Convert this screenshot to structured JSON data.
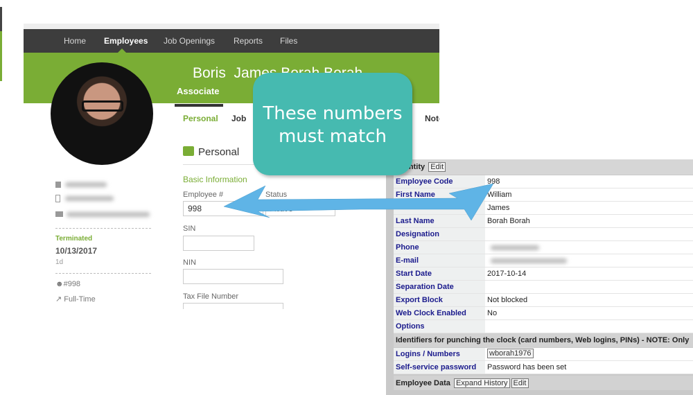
{
  "nav": {
    "items": [
      "Home",
      "Employees",
      "Job Openings",
      "Reports",
      "Files"
    ],
    "active": "Employees"
  },
  "profile": {
    "first": "Boris",
    "rest": "James Borah Borah",
    "role": "Associate",
    "status_label": "Terminated",
    "status_date": "10/13/2017",
    "status_age": "1d",
    "employee_no": "#998",
    "employment_type": "Full-Time"
  },
  "tabs": [
    "Personal",
    "Job",
    "Note"
  ],
  "personal": {
    "heading": "Personal",
    "section": "Basic Information",
    "employee_label": "Employee #",
    "employee_value": "998",
    "status_label": "Status",
    "status_value": "Active",
    "sin_label": "SIN",
    "nin_label": "NIN",
    "tfn_label": "Tax File Number"
  },
  "identity": {
    "title": "Identity",
    "edit": "Edit",
    "rows": [
      {
        "k": "Employee Code",
        "v": "998"
      },
      {
        "k": "First Name",
        "v": "William"
      },
      {
        "k": "",
        "v": "James"
      },
      {
        "k": "Last Name",
        "v": "Borah Borah"
      },
      {
        "k": "Designation",
        "v": ""
      },
      {
        "k": "Phone",
        "v": ""
      },
      {
        "k": "E-mail",
        "v": ""
      },
      {
        "k": "Start Date",
        "v": "2017-10-14"
      },
      {
        "k": "Separation Date",
        "v": ""
      },
      {
        "k": "Export Block",
        "v": "Not blocked"
      },
      {
        "k": "Web Clock Enabled",
        "v": "No"
      },
      {
        "k": "Options",
        "v": ""
      }
    ],
    "section": "Identifiers for punching the clock (card numbers, Web logins, PINs) - NOTE: Only",
    "logins_label": "Logins / Numbers",
    "logins_value": "wborah1976",
    "password_label": "Self-service password",
    "password_value": "Password has been set",
    "employee_data": "Employee Data",
    "expand_history": "Expand History",
    "edit2": "Edit"
  },
  "callout": {
    "line1": "These numbers",
    "line2": "must match",
    "color": "#46bab0"
  },
  "colors": {
    "brand_green": "#7aad35",
    "nav": "#3d3d3d",
    "arrow": "#5fb4e6",
    "label_blue": "#1a1a8c"
  }
}
